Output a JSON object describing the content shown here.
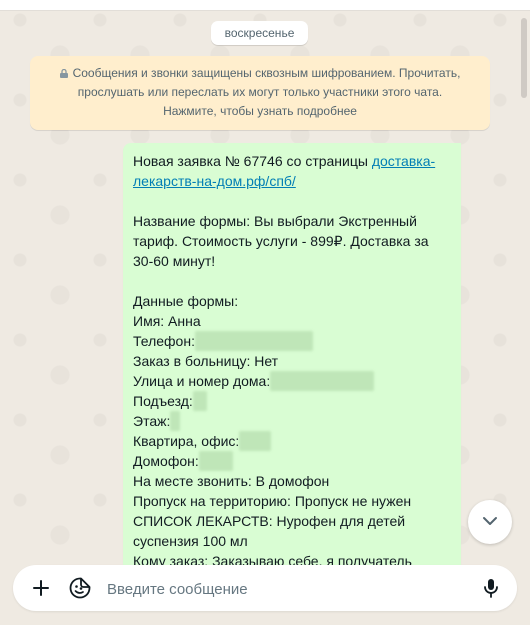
{
  "date_chip": "воскресенье",
  "e2e_notice": {
    "line1": "Сообщения и звонки защищены сквозным шифрованием. Прочитать,",
    "line2": "прослушать или переслать их могут только участники этого чата.",
    "line3": "Нажмите, чтобы узнать подробнее"
  },
  "message": {
    "header_prefix": "Новая заявка № 67746 со страницы ",
    "link_part1": "доставка-",
    "link_part2": "лекарств-на-дом.рф/спб/",
    "form_name_1": "Название формы: Вы выбрали Экстренный",
    "form_name_2": "тариф. Стоимость услуги - 899₽. Доставка за",
    "form_name_3": "30-60 минут!",
    "form_data_title": "Данные формы:",
    "name": "Имя: Анна",
    "phone_label": "Телефон:",
    "hospital": "Заказ в больницу: Нет",
    "street_label": "Улица и номер дома:",
    "entrance_label": "Подъезд:",
    "floor_label": "Этаж:",
    "apartment_label": "Квартира, офис:",
    "intercom_label": "Домофон:",
    "call_on_site": "На месте звонить: В домофон",
    "pass": "Пропуск на территорию: Пропуск не нужен",
    "drugs_1": "СПИСОК ЛЕКАРСТВ: Нурофен для детей",
    "drugs_2": "суспензия 100 мл",
    "order_for": "Кому заказ: Заказываю себе, я получатель"
  },
  "composer": {
    "placeholder": "Введите сообщение"
  },
  "icons": {
    "lock": "lock-icon",
    "plus": "plus-icon",
    "sticker": "sticker-icon",
    "mic": "mic-icon",
    "scroll_down": "chevron-down-icon"
  },
  "colors": {
    "outgoing_bubble": "#d9fdd3",
    "notice_bg": "#ffeecd",
    "link": "#027eb5",
    "chat_bg": "#efeae2"
  }
}
